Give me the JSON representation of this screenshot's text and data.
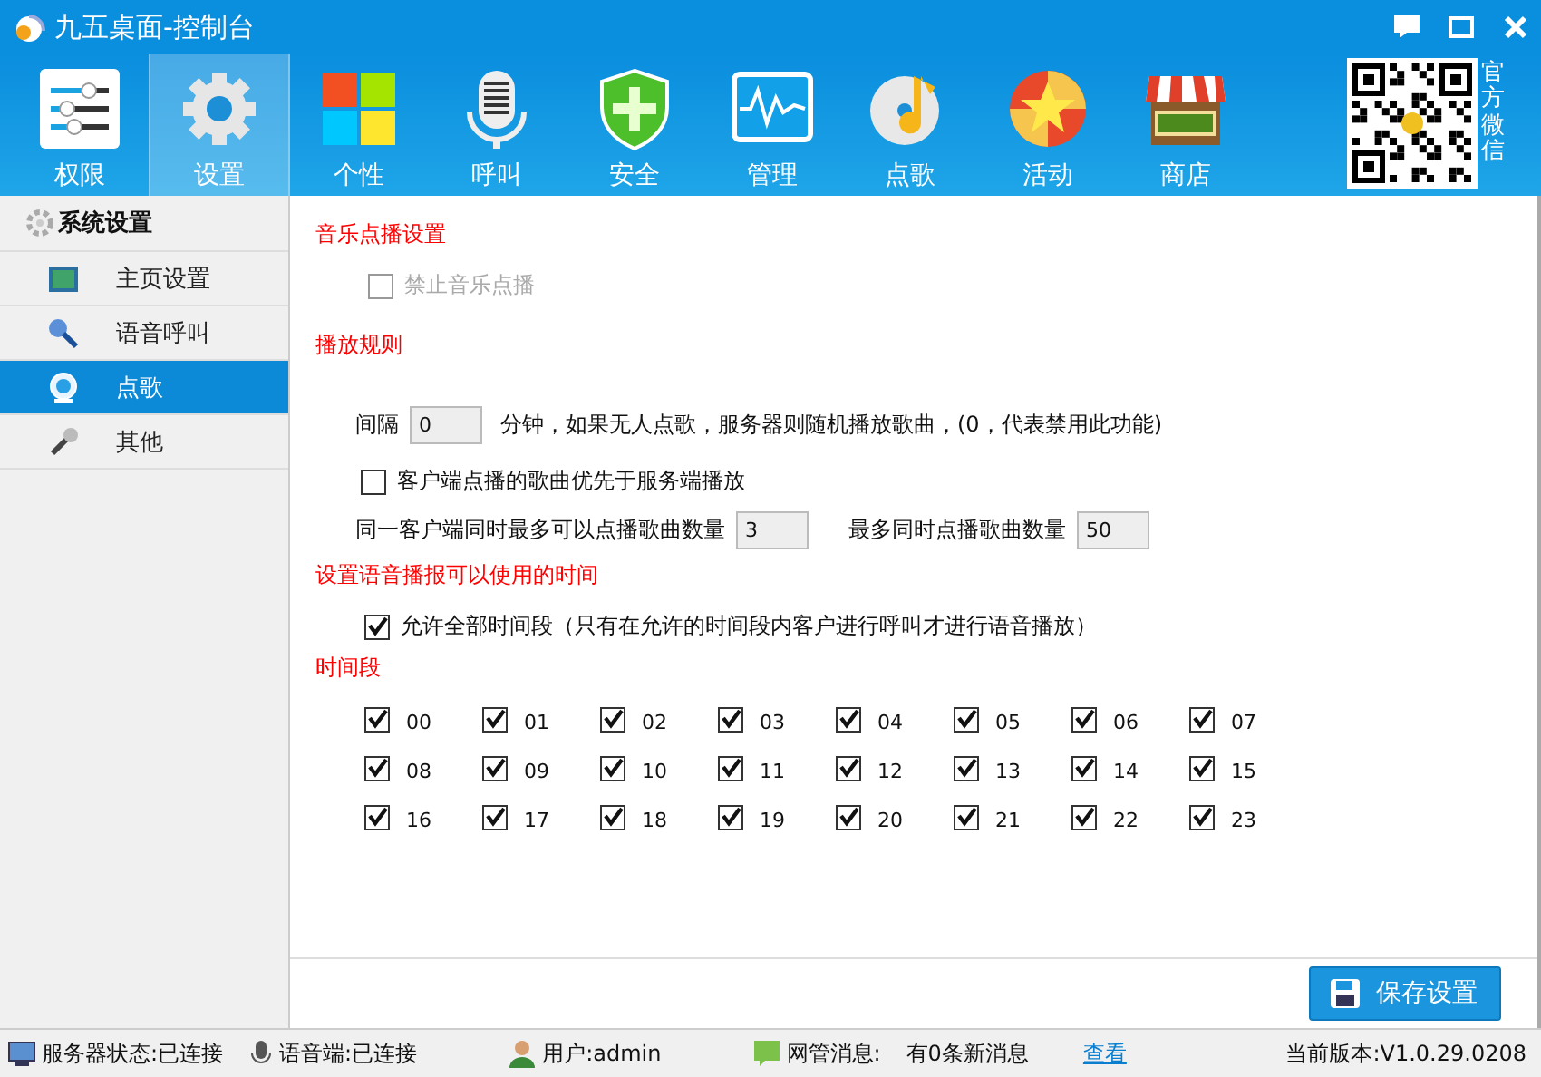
{
  "window": {
    "title": "九五桌面-控制台"
  },
  "toolbar": [
    {
      "label": "权限",
      "kind": "sliders",
      "selected": false
    },
    {
      "label": "设置",
      "kind": "gear",
      "selected": true
    },
    {
      "label": "个性",
      "kind": "tiles",
      "selected": false
    },
    {
      "label": "呼叫",
      "kind": "mic",
      "selected": false
    },
    {
      "label": "安全",
      "kind": "shield",
      "selected": false
    },
    {
      "label": "管理",
      "kind": "monitor",
      "selected": false
    },
    {
      "label": "点歌",
      "kind": "disc",
      "selected": false
    },
    {
      "label": "活动",
      "kind": "star",
      "selected": false
    },
    {
      "label": "商店",
      "kind": "market",
      "selected": false
    }
  ],
  "qr_caption": "官方微信",
  "sidebar": {
    "header": "系统设置",
    "items": [
      {
        "label": "主页设置",
        "kind": "home",
        "selected": false
      },
      {
        "label": "语音呼叫",
        "kind": "mic",
        "selected": false
      },
      {
        "label": "点歌",
        "kind": "webcam",
        "selected": true
      },
      {
        "label": "其他",
        "kind": "wrench",
        "selected": false
      }
    ]
  },
  "music": {
    "title": "音乐点播设置",
    "disable_option": {
      "label": "禁止音乐点播",
      "checked": false,
      "disabled": true
    }
  },
  "rules": {
    "title": "播放规则",
    "interval": {
      "label": "间隔",
      "value": "0",
      "note": "分钟，如果无人点歌，服务器则随机播放歌曲，(0，代表禁用此功能)"
    },
    "priority": {
      "label": "客户端点播的歌曲优先于服务端播放",
      "checked": false
    },
    "per_client": {
      "label": "同一客户端同时最多可以点播歌曲数量",
      "value": "3"
    },
    "max_total": {
      "label": "最多同时点播歌曲数量",
      "value": "50"
    }
  },
  "voice": {
    "title": "设置语音播报可以使用的时间",
    "allow_all": {
      "label": "允许全部时间段（只有在允许的时间段内客户进行呼叫才进行语音播放）",
      "checked": true
    },
    "slots_title": "时间段",
    "slots": [
      {
        "label": "00",
        "checked": true
      },
      {
        "label": "01",
        "checked": true
      },
      {
        "label": "02",
        "checked": true
      },
      {
        "label": "03",
        "checked": true
      },
      {
        "label": "04",
        "checked": true
      },
      {
        "label": "05",
        "checked": true
      },
      {
        "label": "06",
        "checked": true
      },
      {
        "label": "07",
        "checked": true
      },
      {
        "label": "08",
        "checked": true
      },
      {
        "label": "09",
        "checked": true
      },
      {
        "label": "10",
        "checked": true
      },
      {
        "label": "11",
        "checked": true
      },
      {
        "label": "12",
        "checked": true
      },
      {
        "label": "13",
        "checked": true
      },
      {
        "label": "14",
        "checked": true
      },
      {
        "label": "15",
        "checked": true
      },
      {
        "label": "16",
        "checked": true
      },
      {
        "label": "17",
        "checked": true
      },
      {
        "label": "18",
        "checked": true
      },
      {
        "label": "19",
        "checked": true
      },
      {
        "label": "20",
        "checked": true
      },
      {
        "label": "21",
        "checked": true
      },
      {
        "label": "22",
        "checked": true
      },
      {
        "label": "23",
        "checked": true
      }
    ]
  },
  "save_button": "保存设置",
  "status_bar": {
    "server": "服务器状态:已连接",
    "voice": "语音端:已连接",
    "user": "用户:admin",
    "message_label": "网管消息:",
    "message": "有0条新消息",
    "view_link": "查看",
    "version": "当前版本:V1.0.29.0208"
  }
}
